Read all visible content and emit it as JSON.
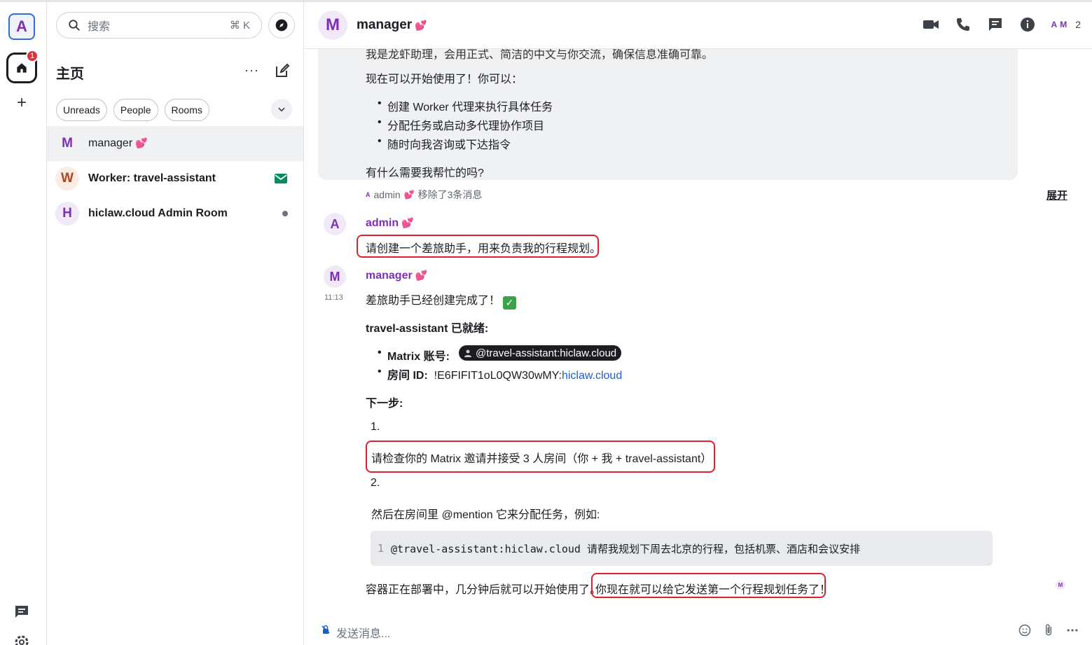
{
  "rail": {
    "space_initial": "A",
    "home_badge": "1",
    "add_label": "+"
  },
  "left": {
    "search_placeholder": "搜索",
    "search_shortcut": "⌘ K",
    "home_title": "主页",
    "home_more": "···",
    "chips": [
      "Unreads",
      "People",
      "Rooms"
    ],
    "rooms": [
      {
        "initial": "M",
        "name": "manager",
        "heart": "💕",
        "color": "#7e2fb3",
        "bg": "#f1e8f8",
        "bold": false,
        "active": true
      },
      {
        "initial": "W",
        "name": "Worker: travel-assistant",
        "heart": "",
        "color": "#b0451f",
        "bg": "#fbece4",
        "bold": true,
        "active": false,
        "indicator": "envelope"
      },
      {
        "initial": "H",
        "name": "hiclaw.cloud Admin Room",
        "heart": "",
        "color": "#7e2fb3",
        "bg": "#f1e8f8",
        "bold": true,
        "active": false,
        "indicator": "dot"
      }
    ]
  },
  "header": {
    "initial": "M",
    "room_name": "manager",
    "heart": "💕",
    "members": [
      "A",
      "M"
    ],
    "member_count": "2"
  },
  "timeline": {
    "prev": {
      "cut_line": "我是龙虾助理，会用正式、简洁的中文与你交流，确保信息准确可靠。",
      "intro": "现在可以开始使用了！你可以：",
      "bullets": [
        "创建 Worker 代理来执行具体任务",
        "分配任务或启动多代理协作项目",
        "随时向我咨询或下达指令"
      ],
      "question": "有什么需要我帮忙的吗?"
    },
    "system": {
      "avatar": "A",
      "text": "admin",
      "heart": "💕",
      "action": "移除了3条消息",
      "expand": "展开"
    },
    "admin_msg": {
      "avatar": "A",
      "sender": "admin",
      "heart": "💕",
      "body": "请创建一个差旅助手，用来负责我的行程规划。"
    },
    "manager_msg": {
      "avatar": "M",
      "sender": "manager",
      "heart": "💕",
      "time": "11:13",
      "line1": "差旅助手已经创建完成了！",
      "ready_title": "travel-assistant 已就绪:",
      "matrix_label": "Matrix 账号:",
      "matrix_pill": "@travel-assistant:hiclaw.cloud",
      "room_label": "房间 ID:",
      "room_id": "!E6FIFIT1oL0QW30wMY:",
      "room_domain": "hiclaw.cloud",
      "next_title": "下一步:",
      "step1_num": "1.",
      "step1": "请检查你的 Matrix 邀请并接受 3 人房间（你 + 我 + travel-assistant）",
      "step2_num": "2.",
      "step2": "然后在房间里 @mention 它来分配任务，例如:",
      "code_line_no": "1",
      "code": "@travel-assistant:hiclaw.cloud 请帮我规划下周去北京的行程，包括机票、酒店和会议安排",
      "footer_a": "容器正在部署中，几分钟后就可以开始使用了。",
      "footer_b": "你现在就可以给它发送第一个行程规划任务了！",
      "read_receipt": "M"
    }
  },
  "composer": {
    "placeholder": "发送消息..."
  },
  "colors": {
    "accent": "#7e2fb3",
    "highlight_border": "#e0202e",
    "badge": "#e0303b",
    "link": "#1e5fc2"
  }
}
